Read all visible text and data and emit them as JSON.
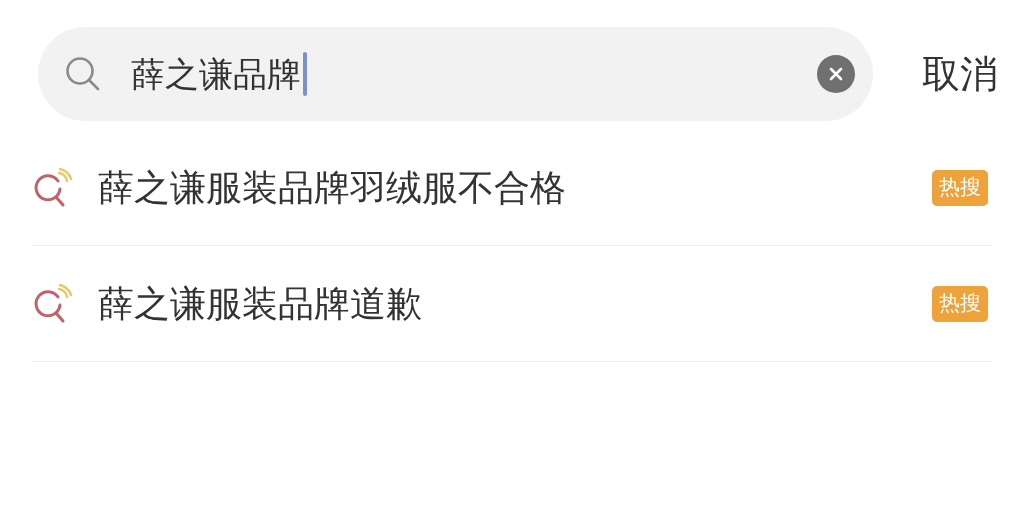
{
  "search": {
    "value": "薛之谦品牌",
    "focused": true
  },
  "cancel": "取消",
  "suggestions": [
    {
      "text": "薛之谦服装品牌羽绒服不合格",
      "badge": "热搜"
    },
    {
      "text": "薛之谦服装品牌道歉",
      "badge": "热搜"
    }
  ]
}
